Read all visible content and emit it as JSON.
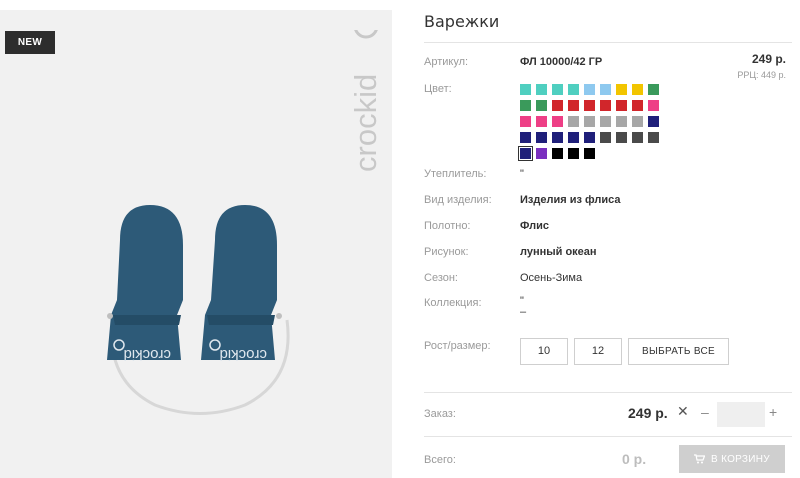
{
  "image": {
    "badge": "NEW",
    "brand_logo": "crockid"
  },
  "product": {
    "title": "Варежки",
    "price": "249 р.",
    "rrp": "РРЦ: 449 р."
  },
  "details": {
    "article_label": "Артикул:",
    "article_value": "ФЛ 10000/42 ГР",
    "color_label": "Цвет:",
    "insulation_label": "Утеплитель:",
    "insulation_value": "\"",
    "type_label": "Вид изделия:",
    "type_value": "Изделия из флиса",
    "fabric_label": "Полотно:",
    "fabric_value": "Флис",
    "pattern_label": "Рисунок:",
    "pattern_value": "лунный океан",
    "season_label": "Сезон:",
    "season_value": "Осень-Зима",
    "collection_label": "Коллекция:",
    "collection_value_1": "\"",
    "collection_value_2": "–",
    "size_label": "Рост/размер:"
  },
  "colors": [
    "#4fcfc0",
    "#4fcfc0",
    "#4fcfc0",
    "#4fcfc0",
    "#8ec9ef",
    "#8ec9ef",
    "#f2c500",
    "#f2c500",
    "#3a9a5b",
    "#3a9a5b",
    "#3a9a5b",
    "#d1262b",
    "#d1262b",
    "#d1262b",
    "#d1262b",
    "#d1262b",
    "#d1262b",
    "#ee3f86",
    "#ee3f86",
    "#ee3f86",
    "#ee3f86",
    "#a7a7a7",
    "#a7a7a7",
    "#a7a7a7",
    "#a7a7a7",
    "#a7a7a7",
    "#1f1f7a",
    "#1f1f7a",
    "#1f1f7a",
    "#1f1f7a",
    "#1f1f7a",
    "#1f1f7a",
    "#4a4a4a",
    "#4a4a4a",
    "#4a4a4a",
    "#4a4a4a",
    "#1f1f7a",
    "#7a2fbf",
    "#000000",
    "#000000",
    "#000000"
  ],
  "selected_color_index": 36,
  "sizes": {
    "options": [
      "10",
      "12"
    ],
    "select_all_label": "ВЫБРАТЬ ВСЕ"
  },
  "order": {
    "label": "Заказ:",
    "total": "249 р.",
    "clear_symbol": "✕",
    "minus_symbol": "–",
    "plus_symbol": "+",
    "quantity": ""
  },
  "summary": {
    "label": "Всего:",
    "total": "0 р.",
    "cart_button_label": "В КОРЗИНУ",
    "cart_icon": "cart-icon"
  }
}
